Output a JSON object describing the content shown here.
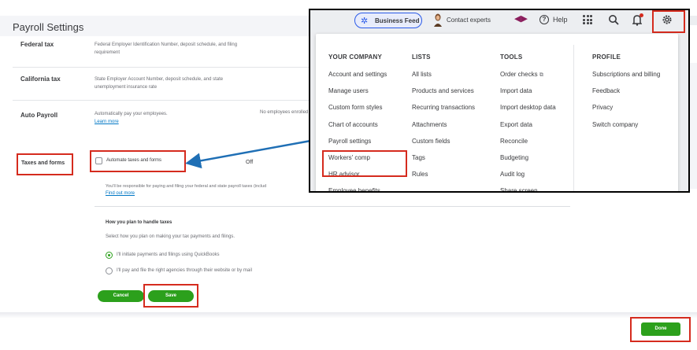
{
  "page": {
    "title": "Payroll Settings"
  },
  "rows": [
    {
      "label": "Federal tax",
      "desc": "Federal Employer Identification Number, deposit schedule, and filing requirement"
    },
    {
      "label": "California tax",
      "desc": "State Employer Account Number, deposit schedule, and state unemployment insurance rate"
    },
    {
      "label": "Auto Payroll",
      "desc": "Automatically pay your employees.",
      "link": "Learn more",
      "status": "No employees enrolled"
    }
  ],
  "taxes": {
    "label": "Taxes and forms",
    "checkbox_label": "Automate taxes and forms",
    "checkbox_checked": false,
    "status": "Off",
    "responsibility_text": "You'll be responsible for paying and filing your federal and state payroll taxes (includ",
    "find_out_more": "Find out more"
  },
  "handle_taxes": {
    "title": "How you plan to handle taxes",
    "subtitle": "Select how you plan on making your tax payments and filings.",
    "options": [
      {
        "label": "I'll initiate payments and filings using QuickBooks",
        "checked": true
      },
      {
        "label": "I'll pay and file the right agencies through their website or by mail",
        "checked": false
      }
    ]
  },
  "buttons": {
    "cancel": "Cancel",
    "save": "Save",
    "done": "Done"
  },
  "topbar": {
    "business_feed": "Business Feed",
    "contact_experts": "Contact experts",
    "help": "Help"
  },
  "menu": {
    "columns": [
      {
        "heading": "YOUR COMPANY",
        "items": [
          "Account and settings",
          "Manage users",
          "Custom form styles",
          "Chart of accounts",
          "Payroll settings",
          "Workers' comp",
          "HR advisor",
          "Employee benefits"
        ]
      },
      {
        "heading": "LISTS",
        "items": [
          "All lists",
          "Products and services",
          "Recurring transactions",
          "Attachments",
          "Custom fields",
          "Tags",
          "Rules"
        ]
      },
      {
        "heading": "TOOLS",
        "items": [
          "Order checks",
          "Import data",
          "Import desktop data",
          "Export data",
          "Reconcile",
          "Budgeting",
          "Audit log",
          "Share screen"
        ]
      },
      {
        "heading": "PROFILE",
        "items": [
          "Subscriptions and billing",
          "Feedback",
          "Privacy",
          "Switch company"
        ]
      }
    ]
  },
  "colors": {
    "primary_green": "#2ca01c",
    "highlight_red": "#d52b1e",
    "arrow_blue": "#1f6fb5",
    "link_blue": "#0077c5"
  },
  "icons": {
    "business_feed": "sparkle-icon",
    "contact": "person-icon",
    "help": "help-icon",
    "apps": "grid-icon",
    "search": "search-icon",
    "notifications": "bell-icon",
    "settings": "gear-icon",
    "external": "external-link-icon"
  }
}
